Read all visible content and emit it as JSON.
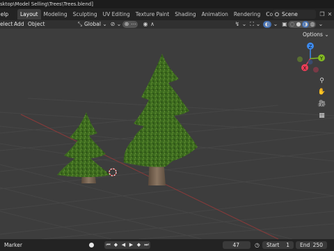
{
  "title_bar": {
    "path": "sktop\\Model Selling\\Trees\\Trees.blend]"
  },
  "top_menu": {
    "help_label": "Help"
  },
  "workspace_tabs": [
    {
      "label": "Layout",
      "active": true
    },
    {
      "label": "Modeling",
      "active": false
    },
    {
      "label": "Sculpting",
      "active": false
    },
    {
      "label": "UV Editing",
      "active": false
    },
    {
      "label": "Texture Paint",
      "active": false
    },
    {
      "label": "Shading",
      "active": false
    },
    {
      "label": "Animation",
      "active": false
    },
    {
      "label": "Rendering",
      "active": false
    },
    {
      "label": "Compositin",
      "active": false
    }
  ],
  "scene": {
    "label": "Scene"
  },
  "viewport_header": {
    "select_label": "elect",
    "add_label": "Add",
    "object_label": "Object",
    "transform_orientation": "Global",
    "options_label": "Options"
  },
  "gizmo": {
    "x_label": "X",
    "y_label": "Y",
    "z_label": "Z"
  },
  "timeline": {
    "marker_label": "Marker",
    "current_frame": "47",
    "start_label": "Start",
    "start_value": "1",
    "end_label": "End",
    "end_value": "250"
  },
  "colors": {
    "accent": "#4772b3",
    "x_axis": "#ec3d57",
    "y_axis": "#83ba22",
    "z_axis": "#3d8bf0",
    "tree_green": "#3f6b1f",
    "trunk": "#7a6450"
  }
}
